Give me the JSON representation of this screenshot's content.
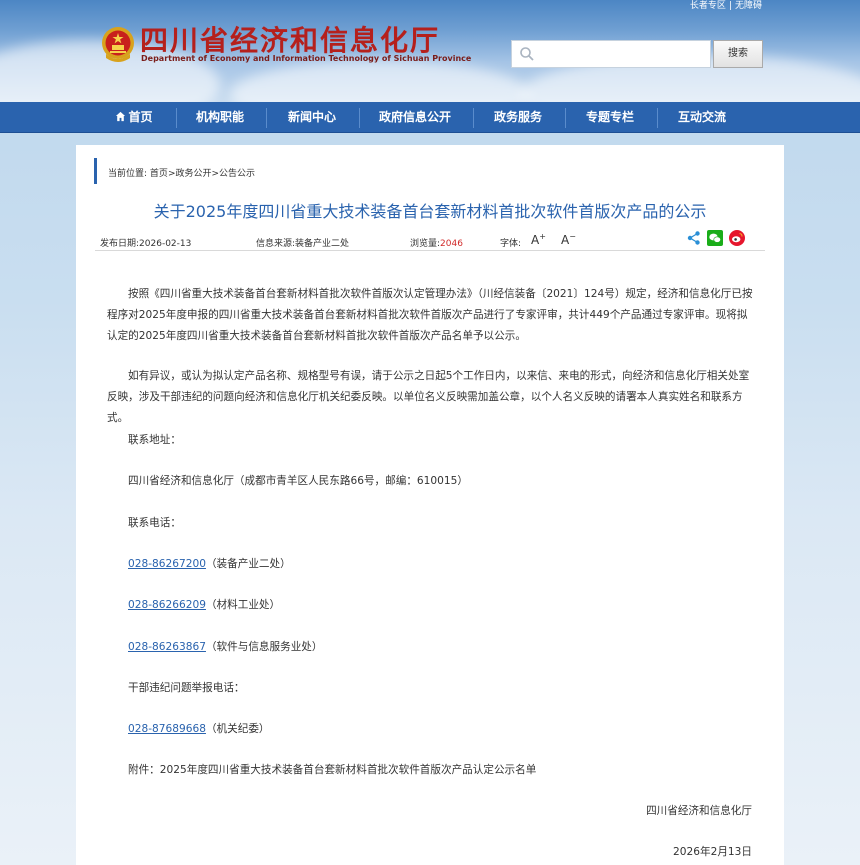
{
  "header": {
    "top_links": [
      "长者专区",
      "无障碍"
    ],
    "top_links_sep": "|",
    "site_title": "四川省经济和信息化厅",
    "site_title_en": "Department of Economy and Information Technology of Sichuan Province",
    "search_placeholder": "",
    "search_button": "搜索"
  },
  "nav": {
    "items": [
      "首页",
      "机构职能",
      "新闻中心",
      "政府信息公开",
      "政务服务",
      "专题专栏",
      "互动交流"
    ],
    "home_icon": "home-icon"
  },
  "breadcrumb": {
    "prefix": "当前位置:",
    "path": [
      "首页",
      "政务公开",
      "公告公示"
    ],
    "separator": ">"
  },
  "article": {
    "title": "关于2025年度四川省重大技术装备首台套新材料首批次软件首版次产品的公示",
    "publish_label": "发布日期:",
    "publish_date": "2026-02-13",
    "source_label": "信息来源:",
    "source": "装备产业二处",
    "views_label": "浏览量:",
    "views": "2046",
    "font_label": "字体:",
    "font_increase": "A",
    "font_decrease": "A",
    "paragraphs": [
      "按照《四川省重大技术装备首台套新材料首批次软件首版次认定管理办法》（川经信装备〔2021〕124号）规定，经济和信息化厅已按程序对2025年度申报的四川省重大技术装备首台套新材料首批次软件首版次产品进行了专家评审，共计449个产品通过专家评审。现将拟认定的2025年度四川省重大技术装备首台套新材料首批次软件首版次产品名单予以公示。",
      "如有异议，或认为拟认定产品名称、规格型号有误，请于公示之日起5个工作日内，以来信、来电的形式，向经济和信息化厅相关处室反映，涉及干部违纪的问题向经济和信息化厅机关纪委反映。以单位名义反映需加盖公章，以个人名义反映的请署本人真实姓名和联系方式。"
    ],
    "contact_address_label": "联系地址：",
    "contact_address": "四川省经济和信息化厅（成都市青羊区人民东路66号，邮编：610015）",
    "contact_phone_label": "联系电话：",
    "phones": [
      {
        "number": "028-86267200",
        "dept": "（装备产业二处）"
      },
      {
        "number": "028-86266209",
        "dept": "（材料工业处）"
      },
      {
        "number": "028-86263867",
        "dept": "（软件与信息服务业处）"
      }
    ],
    "discipline_label": "干部违纪问题举报电话：",
    "discipline_phone": {
      "number": "028-87689668",
      "dept": "（机关纪委）"
    },
    "attachment": "附件：2025年度四川省重大技术装备首台套新材料首批次软件首版次产品认定公示名单",
    "signature": "四川省经济和信息化厅",
    "sign_date": "2026年2月13日"
  },
  "colors": {
    "nav_blue": "#2a63ae",
    "title_red": "#b5201c",
    "views_red": "#d12b2b",
    "wechat_green": "#1aad19",
    "weibo_red": "#e6162d"
  }
}
